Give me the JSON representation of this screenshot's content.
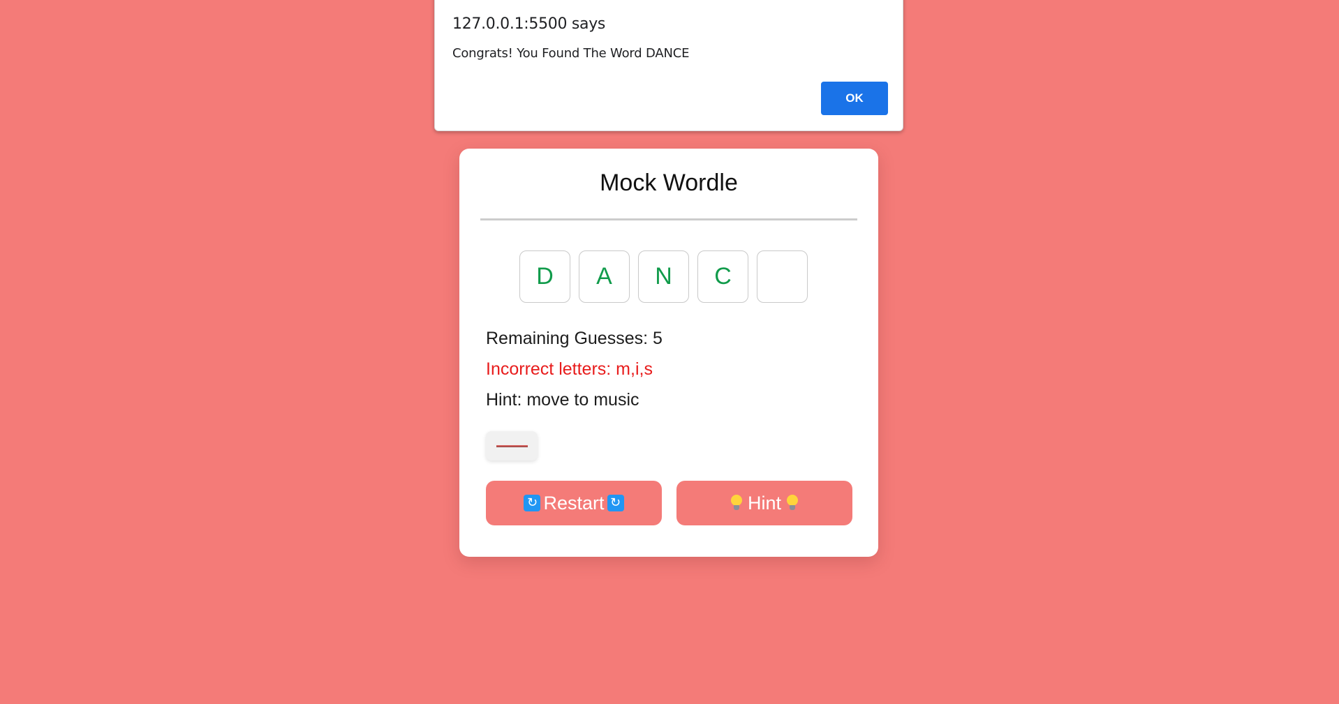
{
  "alert": {
    "title": "127.0.0.1:5500 says",
    "message": "Congrats! You Found The Word DANCE",
    "ok_label": "OK"
  },
  "game": {
    "title": "Mock Wordle",
    "tiles": [
      "D",
      "A",
      "N",
      "C",
      ""
    ],
    "remaining_guesses": "Remaining Guesses: 5",
    "incorrect_letters": "Incorrect letters: m,i,s",
    "hint_text": "Hint: move to music",
    "restart_label": "Restart",
    "hint_label": "Hint",
    "restart_icon": "refresh-icon",
    "hint_icon": "lightbulb-icon"
  },
  "colors": {
    "background": "#f47b78",
    "correct_letter": "#119b4b",
    "incorrect_text": "#e81c1c",
    "alert_button": "#1a73e8"
  }
}
